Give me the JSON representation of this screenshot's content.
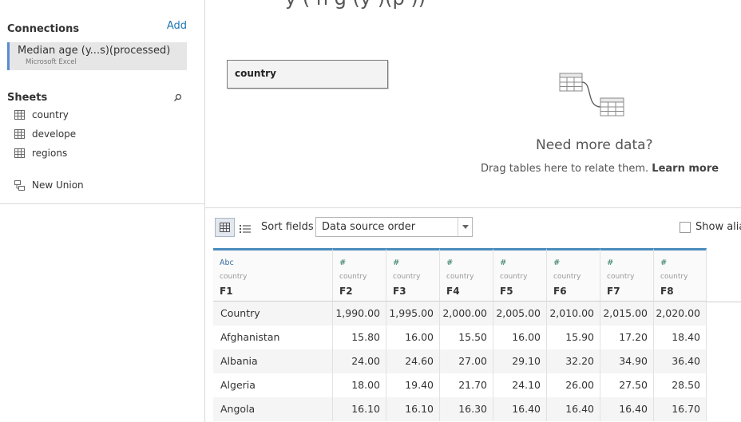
{
  "connections": {
    "title": "Connections",
    "add_label": "Add",
    "items": [
      {
        "name": "Median age (y...s)(processed)",
        "type": "Microsoft Excel"
      }
    ]
  },
  "sheets": {
    "title": "Sheets",
    "items": [
      {
        "label": "country",
        "icon": "table-icon"
      },
      {
        "label": "develope",
        "icon": "table-icon"
      },
      {
        "label": "regions",
        "icon": "table-icon"
      }
    ],
    "new_union_label": "New Union"
  },
  "canvas": {
    "title_fragment": "y (    n   g  (y    )(p         ))",
    "table_box_label": "country",
    "need_more": "Need more data?",
    "drag_text": "Drag tables here to relate them.",
    "learn_more": "Learn more"
  },
  "toolbar": {
    "sort_label": "Sort fields",
    "sort_value": "Data source order",
    "show_alias_label": "Show alia"
  },
  "grid": {
    "columns": [
      {
        "type": "Abc",
        "source": "country",
        "name": "F1"
      },
      {
        "type": "#",
        "source": "country",
        "name": "F2"
      },
      {
        "type": "#",
        "source": "country",
        "name": "F3"
      },
      {
        "type": "#",
        "source": "country",
        "name": "F4"
      },
      {
        "type": "#",
        "source": "country",
        "name": "F5"
      },
      {
        "type": "#",
        "source": "country",
        "name": "F6"
      },
      {
        "type": "#",
        "source": "country",
        "name": "F7"
      },
      {
        "type": "#",
        "source": "country",
        "name": "F8"
      }
    ],
    "rows": [
      [
        "Country",
        "1,990.00",
        "1,995.00",
        "2,000.00",
        "2,005.00",
        "2,010.00",
        "2,015.00",
        "2,020.00"
      ],
      [
        "Afghanistan",
        "15.80",
        "16.00",
        "15.50",
        "16.00",
        "15.90",
        "17.20",
        "18.40"
      ],
      [
        "Albania",
        "24.00",
        "24.60",
        "27.00",
        "29.10",
        "32.20",
        "34.90",
        "36.40"
      ],
      [
        "Algeria",
        "18.00",
        "19.40",
        "21.70",
        "24.10",
        "26.00",
        "27.50",
        "28.50"
      ],
      [
        "Angola",
        "16.10",
        "16.10",
        "16.30",
        "16.40",
        "16.40",
        "16.40",
        "16.70"
      ]
    ]
  }
}
